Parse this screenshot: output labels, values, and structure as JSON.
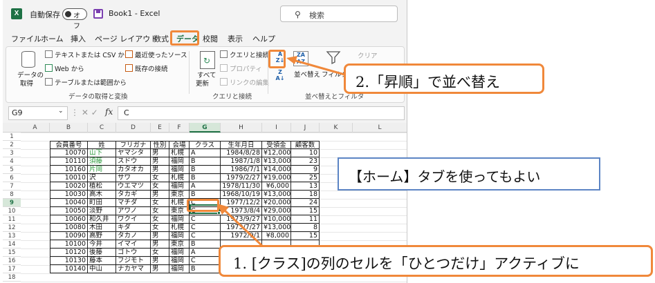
{
  "titlebar": {
    "logo": "X",
    "autosave_label": "自動保存",
    "autosave_state": "オフ",
    "book_title": "Book1  -  Excel",
    "search_placeholder": "検索"
  },
  "tabs": [
    "ファイル",
    "ホーム",
    "挿入",
    "ページ レイアウト",
    "数式",
    "データ",
    "校閲",
    "表示",
    "ヘルプ"
  ],
  "ribbon": {
    "get_data": {
      "big_button_line1": "データの",
      "big_button_line2": "取得",
      "from_text_csv": "テキストまたは CSV から",
      "from_web": "Web から",
      "from_table": "テーブルまたは範囲から",
      "recent_sources": "最近使ったソース",
      "existing_connections": "既存の接続",
      "group_label": "データの取得と変換"
    },
    "queries": {
      "refresh_line1": "すべて",
      "refresh_line2": "更新",
      "queries_connections": "クエリと接続",
      "properties": "プロパティ",
      "edit_links": "リンクの編集",
      "group_label": "クエリと接続"
    },
    "sort_filter": {
      "sort_label": "並べ替え",
      "filter_label": "フィルタ",
      "clear_label": "クリア",
      "group_label": "並べ替えとフィルタ"
    }
  },
  "formula_bar": {
    "namebox": "G9",
    "fx": "fx",
    "value": "C"
  },
  "columns": [
    "A",
    "B",
    "C",
    "D",
    "E",
    "F",
    "G",
    "H",
    "I",
    "J",
    "K",
    "L"
  ],
  "rows": [
    "1",
    "2",
    "3",
    "4",
    "5",
    "6",
    "7",
    "8",
    "9",
    "10",
    "11",
    "12",
    "13",
    "14",
    "15",
    "16",
    "17",
    "18"
  ],
  "table_headers": [
    "会員番号",
    "姓",
    "フリガナ",
    "性別",
    "会場",
    "クラス",
    "生年月日",
    "受領金",
    "顧客数"
  ],
  "table_rows": [
    [
      "10070",
      "山下",
      "ヤマシタ",
      "男",
      "札幌",
      "A",
      "1984/8/28",
      "¥12,000",
      "10"
    ],
    [
      "10110",
      "須藤",
      "スドウ",
      "男",
      "福岡",
      "B",
      "1987/1/8",
      "¥13,000",
      "23"
    ],
    [
      "10160",
      "片岡",
      "カタオカ",
      "男",
      "福岡",
      "B",
      "1986/7/1",
      "¥14,000",
      "9"
    ],
    [
      "10010",
      "沢",
      "サワ",
      "女",
      "札幌",
      "B",
      "1979/2/27",
      "¥19,000",
      "25"
    ],
    [
      "10020",
      "植松",
      "ウエマツ",
      "女",
      "福岡",
      "A",
      "1978/11/30",
      "¥6,000",
      "13"
    ],
    [
      "10030",
      "高木",
      "タカギ",
      "男",
      "東京",
      "B",
      "1968/10/19",
      "¥13,000",
      "18"
    ],
    [
      "10040",
      "町田",
      "マチダ",
      "女",
      "札幌",
      "C",
      "1977/12/2",
      "¥20,000",
      "24"
    ],
    [
      "10050",
      "淡野",
      "アワノ",
      "女",
      "東京",
      "C",
      "1973/8/4",
      "¥29,000",
      "15"
    ],
    [
      "10060",
      "和久井",
      "ワクイ",
      "女",
      "福岡",
      "C",
      "1973/9/27",
      "¥10,000",
      "11"
    ],
    [
      "10080",
      "木田",
      "キダ",
      "女",
      "札幌",
      "C",
      "1973/7/27",
      "¥13,000",
      "8"
    ],
    [
      "10090",
      "高野",
      "タカノ",
      "男",
      "福岡",
      "C",
      "1972/9/1",
      "¥8,000",
      "15"
    ],
    [
      "10100",
      "今井",
      "イマイ",
      "男",
      "東京",
      "B",
      "",
      "",
      ""
    ],
    [
      "10120",
      "後藤",
      "ゴトウ",
      "女",
      "福岡",
      "A",
      "",
      "",
      ""
    ],
    [
      "10130",
      "藤本",
      "フジモト",
      "男",
      "福岡",
      "C",
      "",
      "",
      ""
    ],
    [
      "10140",
      "中山",
      "ナカヤマ",
      "男",
      "福岡",
      "B",
      "",
      "",
      ""
    ]
  ],
  "green_names": [
    "山下",
    "須藤",
    "片岡"
  ],
  "callouts": {
    "step2": "2.「昇順」で並べ替え",
    "note": "【ホーム】タブを使ってもよい",
    "step1": "1. [クラス]の列のセルを「ひとつだけ」アクティブに"
  },
  "colors": {
    "excel_green": "#1e7145",
    "highlight_orange": "#f0883a",
    "note_border_blue": "#5b84c4"
  }
}
